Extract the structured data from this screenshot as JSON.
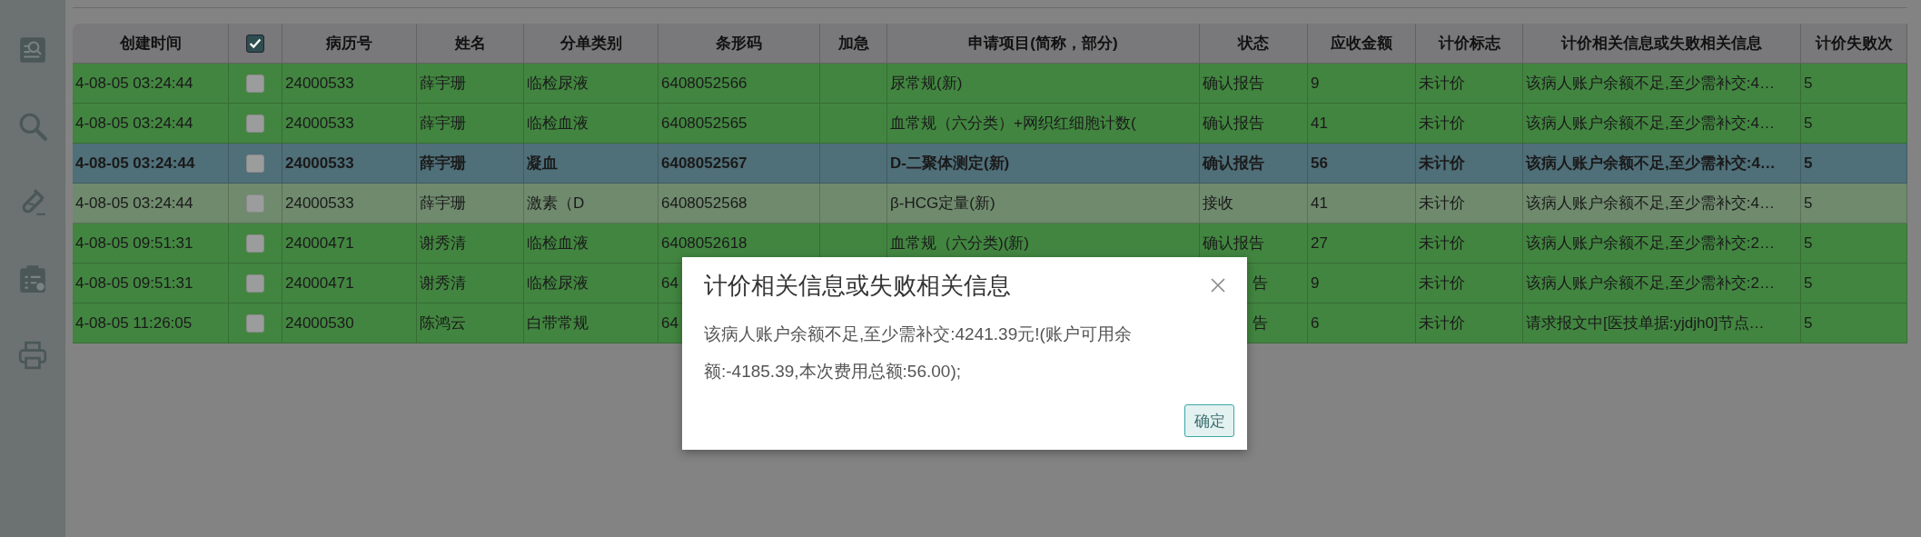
{
  "table": {
    "columns": [
      {
        "label": "创建时间",
        "kind": "text"
      },
      {
        "kind": "checkbox",
        "checked": true
      },
      {
        "label": "病历号",
        "kind": "text"
      },
      {
        "label": "姓名",
        "kind": "text"
      },
      {
        "label": "分单类别",
        "kind": "text"
      },
      {
        "label": "条形码",
        "kind": "text"
      },
      {
        "label": "加急",
        "kind": "text"
      },
      {
        "label": "申请项目(简称，部分)",
        "kind": "text"
      },
      {
        "label": "状态",
        "kind": "text"
      },
      {
        "label": "应收金额",
        "kind": "text"
      },
      {
        "label": "计价标志",
        "kind": "text"
      },
      {
        "label": "计价相关信息或失败相关信息",
        "kind": "text"
      },
      {
        "label": "计价失败次",
        "kind": "text"
      }
    ],
    "rows": [
      {
        "selected": false,
        "hovered": false,
        "checked": false,
        "cells": [
          "4-08-05 03:24:44",
          "",
          "24000533",
          "薛宇珊",
          "临检尿液",
          "6408052566",
          "",
          "尿常规(新)",
          "确认报告",
          "9",
          "未计价",
          "该病人账户余额不足,至少需补交:4…",
          "5"
        ]
      },
      {
        "selected": false,
        "hovered": false,
        "checked": false,
        "cells": [
          "4-08-05 03:24:44",
          "",
          "24000533",
          "薛宇珊",
          "临检血液",
          "6408052565",
          "",
          "血常规（六分类）+网织红细胞计数(",
          "确认报告",
          "41",
          "未计价",
          "该病人账户余额不足,至少需补交:4…",
          "5"
        ]
      },
      {
        "selected": true,
        "hovered": false,
        "checked": false,
        "cells": [
          "4-08-05 03:24:44",
          "",
          "24000533",
          "薛宇珊",
          "凝血",
          "6408052567",
          "",
          "D-二聚体测定(新)",
          "确认报告",
          "56",
          "未计价",
          "该病人账户余额不足,至少需补交:4…",
          "5"
        ]
      },
      {
        "selected": false,
        "hovered": true,
        "checked": false,
        "cells": [
          "4-08-05 03:24:44",
          "",
          "24000533",
          "薛宇珊",
          "激素（D",
          "6408052568",
          "",
          "β-HCG定量(新)",
          "接收",
          "41",
          "未计价",
          "该病人账户余额不足,至少需补交:4…",
          "5"
        ]
      },
      {
        "selected": false,
        "hovered": false,
        "checked": false,
        "cells": [
          "4-08-05 09:51:31",
          "",
          "24000471",
          "谢秀清",
          "临检血液",
          "6408052618",
          "",
          "血常规（六分类)(新)",
          "确认报告",
          "27",
          "未计价",
          "该病人账户余额不足,至少需补交:2…",
          "5"
        ]
      },
      {
        "selected": false,
        "hovered": false,
        "checked": false,
        "cells": [
          "4-08-05 09:51:31",
          "",
          "24000471",
          "谢秀清",
          "临检尿液",
          "64",
          "",
          "",
          "告",
          "9",
          "未计价",
          "该病人账户余额不足,至少需补交:2…",
          "5"
        ]
      },
      {
        "selected": false,
        "hovered": false,
        "checked": false,
        "cells": [
          "4-08-05 11:26:05",
          "",
          "24000530",
          "陈鸿云",
          "白带常规",
          "64",
          "",
          "",
          "告",
          "6",
          "未计价",
          "请求报文中[医技单据:yjdjh0]节点…",
          "5"
        ]
      }
    ]
  },
  "dialog": {
    "title": "计价相关信息或失败相关信息",
    "message": "该病人账户余额不足,至少需补交:4241.39元!(账户可用余额:-4185.39,本次费用总额:56.00);",
    "confirm_button": "确定"
  }
}
